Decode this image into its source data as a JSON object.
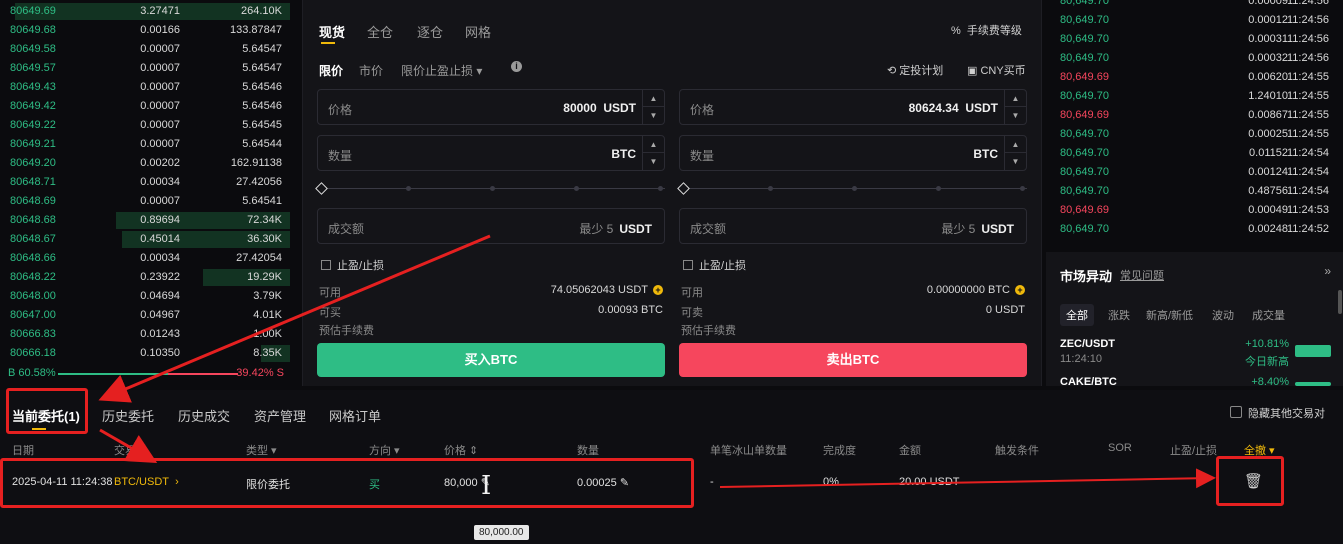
{
  "orderbook": {
    "rows": [
      {
        "price": "80649.69",
        "amount": "3.27471",
        "total": "264.10K"
      },
      {
        "price": "80649.68",
        "amount": "0.00166",
        "total": "133.87847"
      },
      {
        "price": "80649.58",
        "amount": "0.00007",
        "total": "5.64547"
      },
      {
        "price": "80649.57",
        "amount": "0.00007",
        "total": "5.64547"
      },
      {
        "price": "80649.43",
        "amount": "0.00007",
        "total": "5.64546"
      },
      {
        "price": "80649.42",
        "amount": "0.00007",
        "total": "5.64546"
      },
      {
        "price": "80649.22",
        "amount": "0.00007",
        "total": "5.64545"
      },
      {
        "price": "80649.21",
        "amount": "0.00007",
        "total": "5.64544"
      },
      {
        "price": "80649.20",
        "amount": "0.00202",
        "total": "162.91138"
      },
      {
        "price": "80648.71",
        "amount": "0.00034",
        "total": "27.42056"
      },
      {
        "price": "80648.69",
        "amount": "0.00007",
        "total": "5.64541"
      },
      {
        "price": "80648.68",
        "amount": "0.89694",
        "total": "72.34K"
      },
      {
        "price": "80648.67",
        "amount": "0.45014",
        "total": "36.30K"
      },
      {
        "price": "80648.66",
        "amount": "0.00034",
        "total": "27.42054"
      },
      {
        "price": "80648.22",
        "amount": "0.23922",
        "total": "19.29K"
      },
      {
        "price": "80648.00",
        "amount": "0.04694",
        "total": "3.79K"
      },
      {
        "price": "80647.00",
        "amount": "0.04967",
        "total": "4.01K"
      },
      {
        "price": "80666.83",
        "amount": "0.01243",
        "total": "1.00K"
      },
      {
        "price": "80666.18",
        "amount": "0.10350",
        "total": "8.35K"
      }
    ],
    "depth_fill": [
      0.95,
      0,
      0,
      0,
      0,
      0,
      0,
      0,
      0,
      0,
      0,
      0.6,
      0.58,
      0,
      0.3,
      0,
      0,
      0,
      0.1
    ],
    "buy_ratio_label": "B 60.58%",
    "sell_ratio_label": "39.42% S"
  },
  "trade": {
    "mode_tabs": [
      "现货",
      "全仓",
      "逐仓",
      "网格"
    ],
    "fee_link": "手续费等级",
    "type_tabs": [
      "限价",
      "市价",
      "限价止盈止损 ▾"
    ],
    "dca_link": "定投计划",
    "cny_link": "CNY买币",
    "buy": {
      "price_label": "价格",
      "price_value": "80000",
      "price_unit": "USDT",
      "qty_label": "数量",
      "qty_unit": "BTC",
      "total_label": "成交额",
      "total_hint": "最少 5",
      "total_unit": "USDT",
      "tpsl_label": "止盈/止损",
      "avail_label": "可用",
      "avail_value": "74.05062043 USDT",
      "max_label": "可买",
      "max_value": "0.00093 BTC",
      "fee_label": "预估手续费",
      "button": "买入BTC"
    },
    "sell": {
      "price_label": "价格",
      "price_value": "80624.34",
      "price_unit": "USDT",
      "qty_label": "数量",
      "qty_unit": "BTC",
      "total_label": "成交额",
      "total_hint": "最少 5",
      "total_unit": "USDT",
      "tpsl_label": "止盈/止损",
      "avail_label": "可用",
      "avail_value": "0.00000000 BTC",
      "max_label": "可卖",
      "max_value": "0 USDT",
      "fee_label": "预估手续费",
      "button": "卖出BTC"
    }
  },
  "trades": {
    "rows": [
      {
        "price": "80,649.70",
        "amount": "0.00009",
        "time": "11:24:56",
        "side": "buy"
      },
      {
        "price": "80,649.70",
        "amount": "0.00012",
        "time": "11:24:56",
        "side": "buy"
      },
      {
        "price": "80,649.70",
        "amount": "0.00031",
        "time": "11:24:56",
        "side": "buy"
      },
      {
        "price": "80,649.70",
        "amount": "0.00032",
        "time": "11:24:56",
        "side": "buy"
      },
      {
        "price": "80,649.69",
        "amount": "0.00620",
        "time": "11:24:55",
        "side": "sell"
      },
      {
        "price": "80,649.70",
        "amount": "1.24010",
        "time": "11:24:55",
        "side": "buy"
      },
      {
        "price": "80,649.69",
        "amount": "0.00867",
        "time": "11:24:55",
        "side": "sell"
      },
      {
        "price": "80,649.70",
        "amount": "0.00025",
        "time": "11:24:55",
        "side": "buy"
      },
      {
        "price": "80,649.70",
        "amount": "0.01152",
        "time": "11:24:54",
        "side": "buy"
      },
      {
        "price": "80,649.70",
        "amount": "0.00124",
        "time": "11:24:54",
        "side": "buy"
      },
      {
        "price": "80,649.70",
        "amount": "0.48756",
        "time": "11:24:54",
        "side": "buy"
      },
      {
        "price": "80,649.69",
        "amount": "0.00049",
        "time": "11:24:53",
        "side": "sell"
      },
      {
        "price": "80,649.70",
        "amount": "0.00248",
        "time": "11:24:52",
        "side": "buy"
      }
    ]
  },
  "market": {
    "title": "市场异动",
    "faq": "常见问题",
    "tabs": [
      "全部",
      "涨跌",
      "新高/新低",
      "波动",
      "成交量"
    ],
    "items": [
      {
        "symbol": "ZEC/USDT",
        "time": "11:24:10",
        "change": "+10.81%",
        "note": "今日新高"
      },
      {
        "symbol": "CAKE/BTC",
        "time": "",
        "change": "+8.40%",
        "note": ""
      }
    ]
  },
  "orders": {
    "tabs": [
      "当前委托(1)",
      "历史委托",
      "历史成交",
      "资产管理",
      "网格订单"
    ],
    "hide_others": "隐藏其他交易对",
    "columns": [
      "日期",
      "交易对",
      "类型 ▾",
      "方向 ▾",
      "价格 ⇕",
      "数量",
      "单笔冰山单数量",
      "完成度",
      "金额",
      "触发条件",
      "SOR",
      "止盈/止损",
      "全撤 ▾"
    ],
    "row": {
      "date": "2025-04-11 11:24:38",
      "pair": "BTC/USDT",
      "type": "限价委托",
      "side": "买",
      "price": "80,000",
      "amount": "0.00025",
      "iceberg": "-",
      "filled": "0%",
      "total": "20.00 USDT"
    },
    "tooltip": "80,000.00"
  },
  "colors": {
    "buy": "#2ebd85",
    "sell": "#f6465d",
    "accent": "#f0b90b",
    "highlight": "#e52020"
  }
}
